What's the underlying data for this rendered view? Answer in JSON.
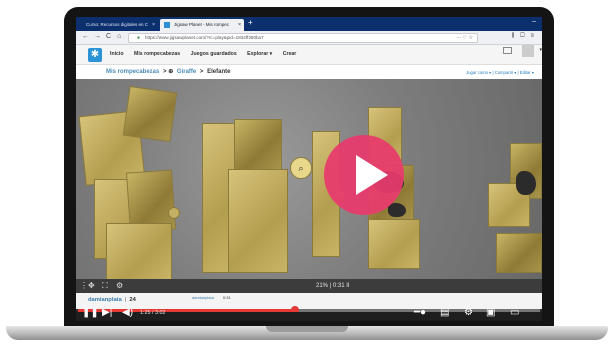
{
  "browser": {
    "tabs": [
      {
        "label": "Curso: Recursos digitales en C"
      },
      {
        "label": "Jigsaw Planet - Mis rompec"
      }
    ],
    "url": "https://www.jigsawplanet.com/?rc=play&pid=1834ff280ba7",
    "new_tab_icon": "plus-icon"
  },
  "site": {
    "logo_icon": "puzzle-logo-icon",
    "menu": [
      "Inicio",
      "Mis rompecabezas",
      "Juegos guardados",
      "Explorar ▾",
      "Crear"
    ]
  },
  "breadcrumb": {
    "root": "Mis rompecabezas",
    "parent": "Giraffe",
    "current": "Elefante"
  },
  "puzzle_actions": {
    "play_as": "Jugar como ▾",
    "share": "Compartir ▾",
    "edit": "Editar ▾"
  },
  "puzzle_status": {
    "progress": "21% | 0:31 II"
  },
  "comment": {
    "user": "damianplata",
    "score": "24",
    "meta_user": "damianplata",
    "meta_time": "0:31"
  },
  "video": {
    "time": "1:25 / 3:02",
    "progress": 0.47,
    "accent": "#e73b6c"
  }
}
